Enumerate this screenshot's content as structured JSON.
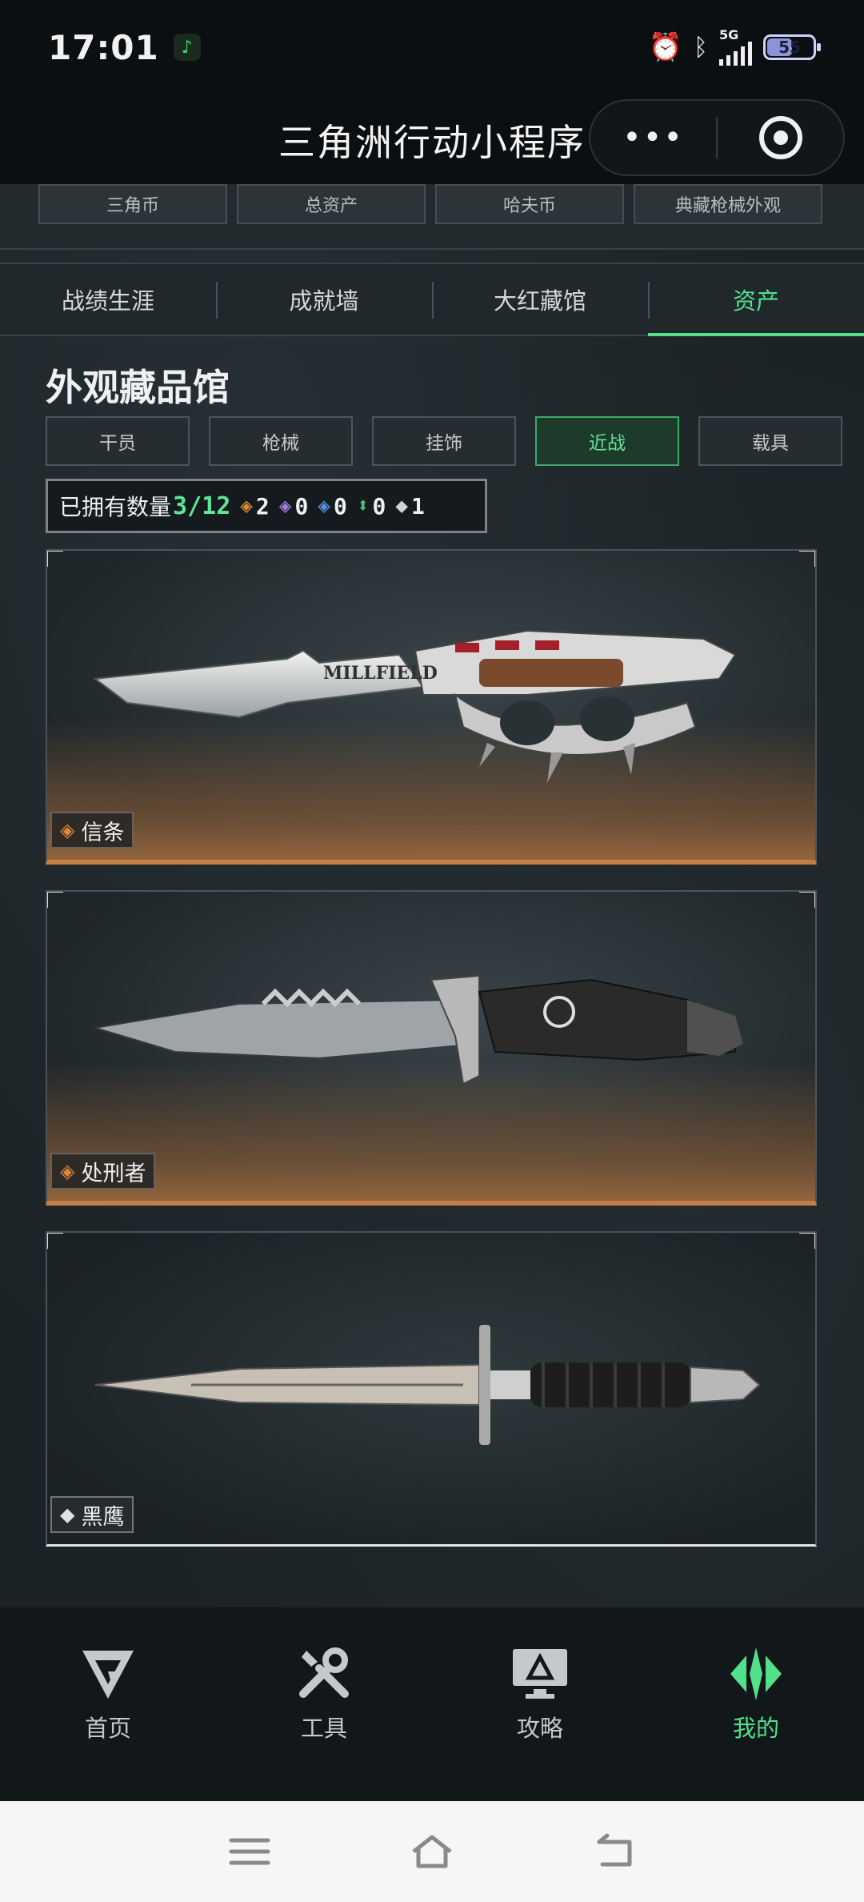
{
  "status_bar": {
    "time": "17:01",
    "network": "5G",
    "battery": "55",
    "battery_level": 0.55,
    "icons": [
      "music-app-icon",
      "alarm-icon",
      "bluetooth-icon",
      "signal-icon",
      "battery-icon"
    ]
  },
  "title_bar": {
    "title": "三角洲行动小程序",
    "more_label": "•••"
  },
  "stat_tabs": [
    "三角币",
    "总资产",
    "哈夫币",
    "典藏枪械外观"
  ],
  "main_tabs": [
    {
      "label": "战绩生涯",
      "active": false
    },
    {
      "label": "成就墙",
      "active": false
    },
    {
      "label": "大红藏馆",
      "active": false
    },
    {
      "label": "资产",
      "active": true
    }
  ],
  "section_title": "外观藏品馆",
  "filters": [
    {
      "label": "干员",
      "active": false
    },
    {
      "label": "枪械",
      "active": false
    },
    {
      "label": "挂饰",
      "active": false
    },
    {
      "label": "近战",
      "active": true
    },
    {
      "label": "载具",
      "active": false
    }
  ],
  "owned": {
    "label": "已拥有数量",
    "count": "3/12",
    "rarities": [
      {
        "icon": "gold-diamond-icon",
        "color": "#e0883a",
        "count": "2"
      },
      {
        "icon": "purple-diamond-icon",
        "color": "#a57be0",
        "count": "0"
      },
      {
        "icon": "blue-diamond-icon",
        "color": "#5a8fe0",
        "count": "0"
      },
      {
        "icon": "green-diamond-icon",
        "color": "#4ec07a",
        "count": "0"
      },
      {
        "icon": "white-diamond-icon",
        "color": "#cfd3d6",
        "count": "1"
      }
    ]
  },
  "items": [
    {
      "name": "信条",
      "rarity_color": "#e0883a",
      "blade_text": "MILLFIELD"
    },
    {
      "name": "处刑者",
      "rarity_color": "#e0883a"
    },
    {
      "name": "黑鹰",
      "rarity_color": "#e0e0e0"
    }
  ],
  "bottom_nav": [
    {
      "label": "首页",
      "icon": "g-logo-icon",
      "active": false
    },
    {
      "label": "工具",
      "icon": "tools-icon",
      "active": false
    },
    {
      "label": "攻略",
      "icon": "monitor-guide-icon",
      "active": false
    },
    {
      "label": "我的",
      "icon": "profile-diamond-icon",
      "active": true
    }
  ],
  "colors": {
    "accent": "#52e08a",
    "gold_rarity": "#c47e46",
    "background": "#1c2326"
  }
}
